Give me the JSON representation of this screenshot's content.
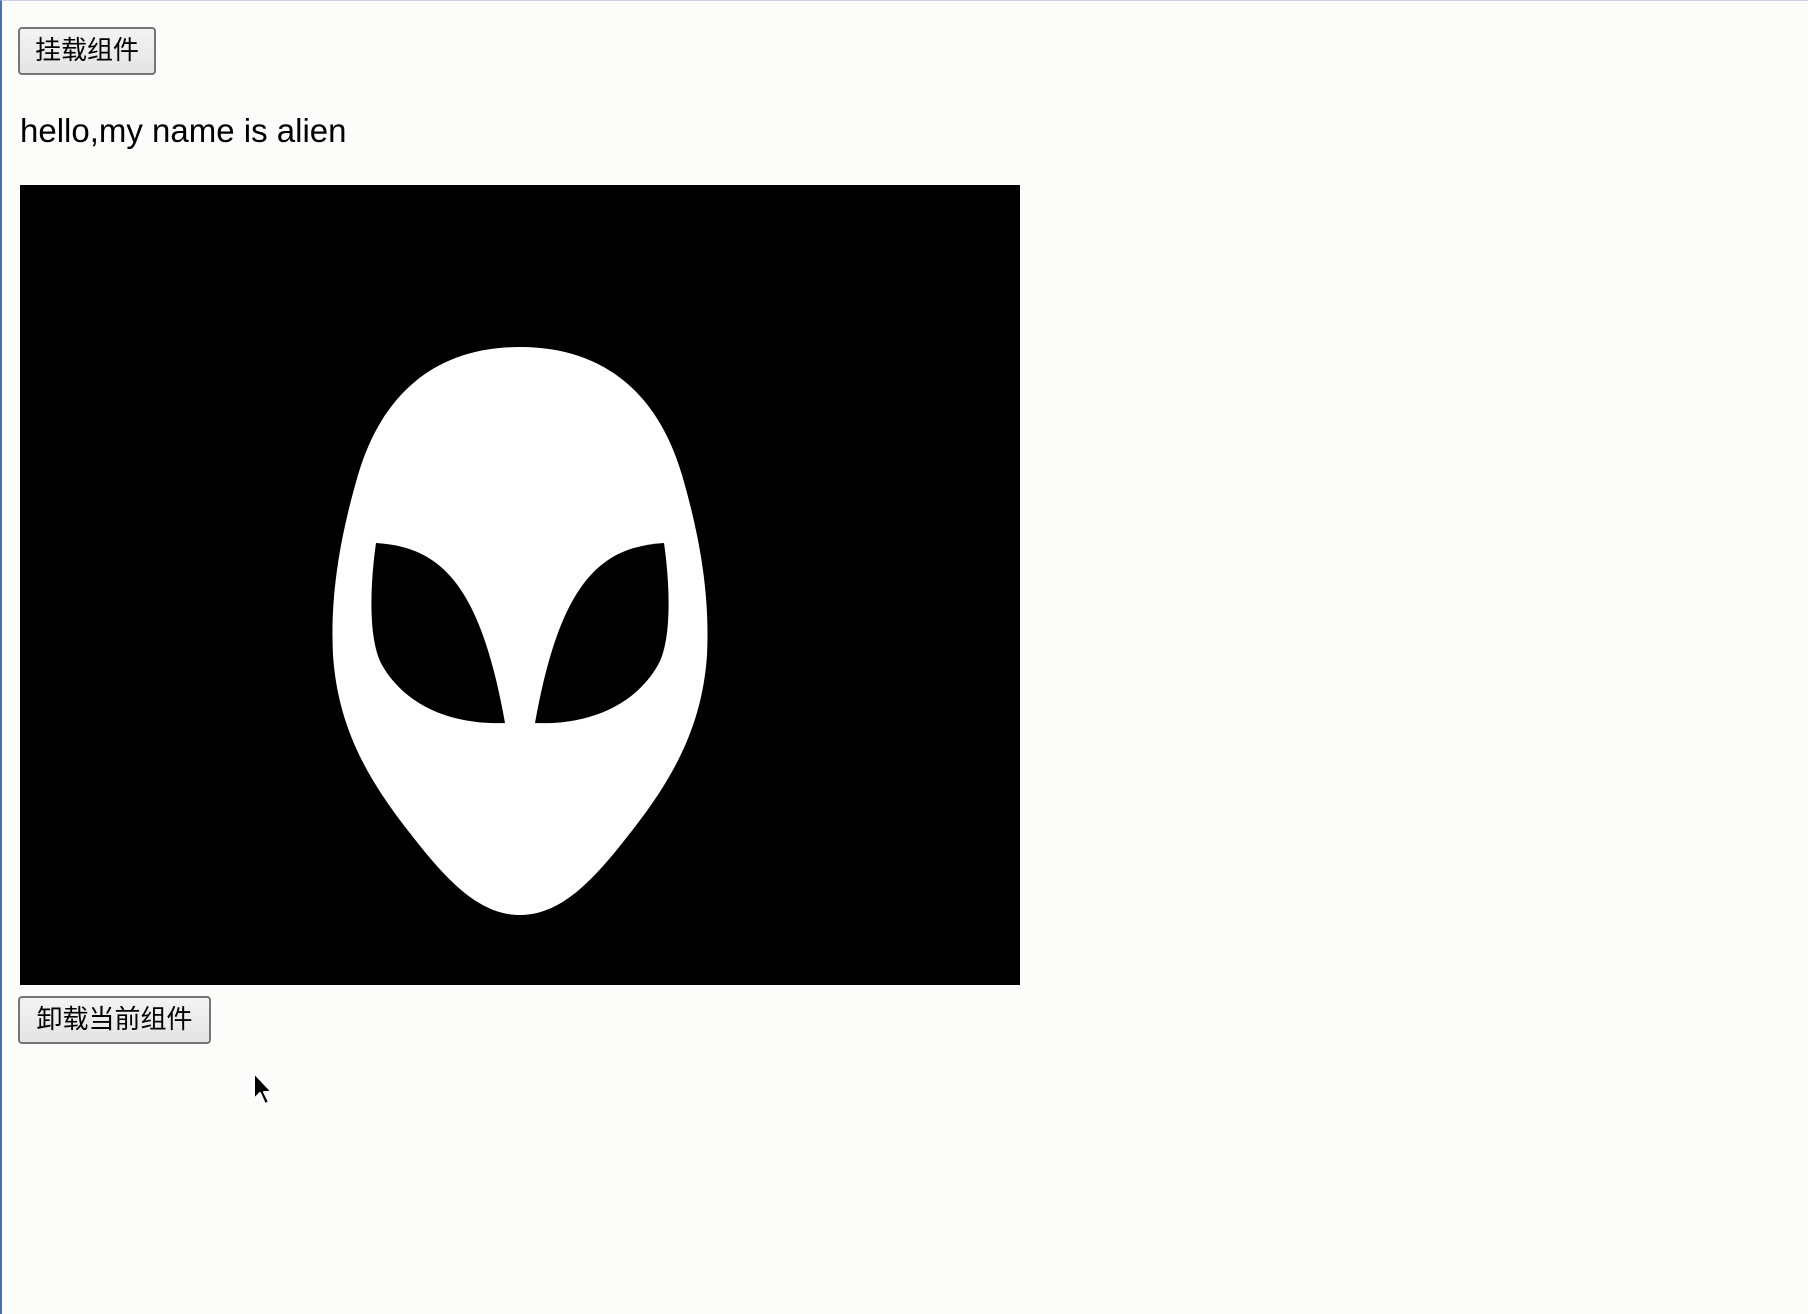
{
  "buttons": {
    "mount_label": "挂载组件",
    "unmount_label": "卸载当前组件"
  },
  "greeting": {
    "text": "hello,my name is alien"
  },
  "image": {
    "icon": "alien-head-icon",
    "background_color": "#000000",
    "figure_color": "#ffffff"
  },
  "cursor": {
    "icon": "mouse-pointer-icon"
  }
}
